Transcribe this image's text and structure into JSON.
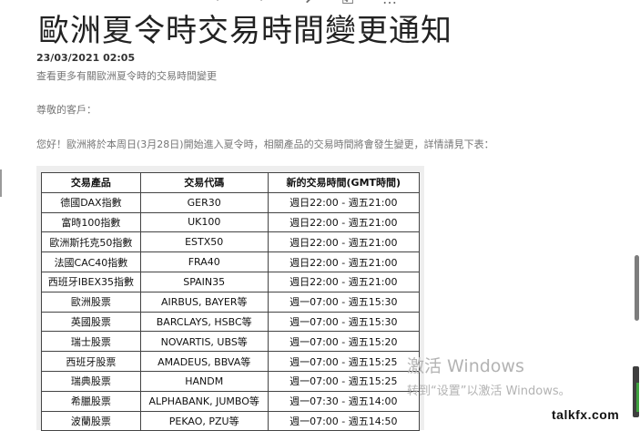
{
  "toolbar": {
    "icons": [
      "reply-icon",
      "reply-all-icon",
      "forward-icon",
      "checkbox-icon",
      "more-icon"
    ],
    "glyphs": [
      "↶",
      "↶",
      "➜",
      "☑",
      "…"
    ]
  },
  "article": {
    "title": "歐洲夏令時交易時間變更通知",
    "date": "23/03/2021 02:05",
    "more_link": "查看更多有關歐洲夏令時的交易時間變更",
    "greeting": "尊敬的客戶：",
    "body": "您好！歐洲將於本周日(3月28日)開始進入夏令時，相關產品的交易時間將會發生變更，詳情請見下表："
  },
  "table": {
    "headers": [
      "交易產品",
      "交易代碼",
      "新的交易時間(GMT時間)"
    ],
    "rows": [
      [
        "德國DAX指數",
        "GER30",
        "週日22:00 - 週五21:00"
      ],
      [
        "富時100指數",
        "UK100",
        "週日22:00 - 週五21:00"
      ],
      [
        "歐洲斯托克50指數",
        "ESTX50",
        "週日22:00 - 週五21:00"
      ],
      [
        "法國CAC40指數",
        "FRA40",
        "週日22:00 - 週五21:00"
      ],
      [
        "西班牙IBEX35指數",
        "SPAIN35",
        "週日22:00 - 週五21:00"
      ],
      [
        "歐洲股票",
        "AIRBUS, BAYER等",
        "週一07:00 - 週五15:30"
      ],
      [
        "英國股票",
        "BARCLAYS, HSBC等",
        "週一07:00 - 週五15:30"
      ],
      [
        "瑞士股票",
        "NOVARTIS, UBS等",
        "週一07:00 - 週五15:20"
      ],
      [
        "西班牙股票",
        "AMADEUS, BBVA等",
        "週一07:00 - 週五15:25"
      ],
      [
        "瑞典股票",
        "HANDM",
        "週一07:00 - 週五15:25"
      ],
      [
        "希臘股票",
        "ALPHABANK, JUMBO等",
        "週一07:30 - 週五14:00"
      ],
      [
        "波蘭股票",
        "PEKAO, PZU等",
        "週一07:00 - 週五14:50"
      ]
    ]
  },
  "watermark": {
    "title": "激活 Windows",
    "subtitle": "转到“设置”以激活 Windows。"
  },
  "logo": {
    "text": "talkfx.com"
  },
  "colors": {
    "title": "#222222",
    "muted_text": "#767676",
    "table_border": "#444444",
    "table_bg": "#eeeeee",
    "scroll_accent": "#3fa33f"
  }
}
